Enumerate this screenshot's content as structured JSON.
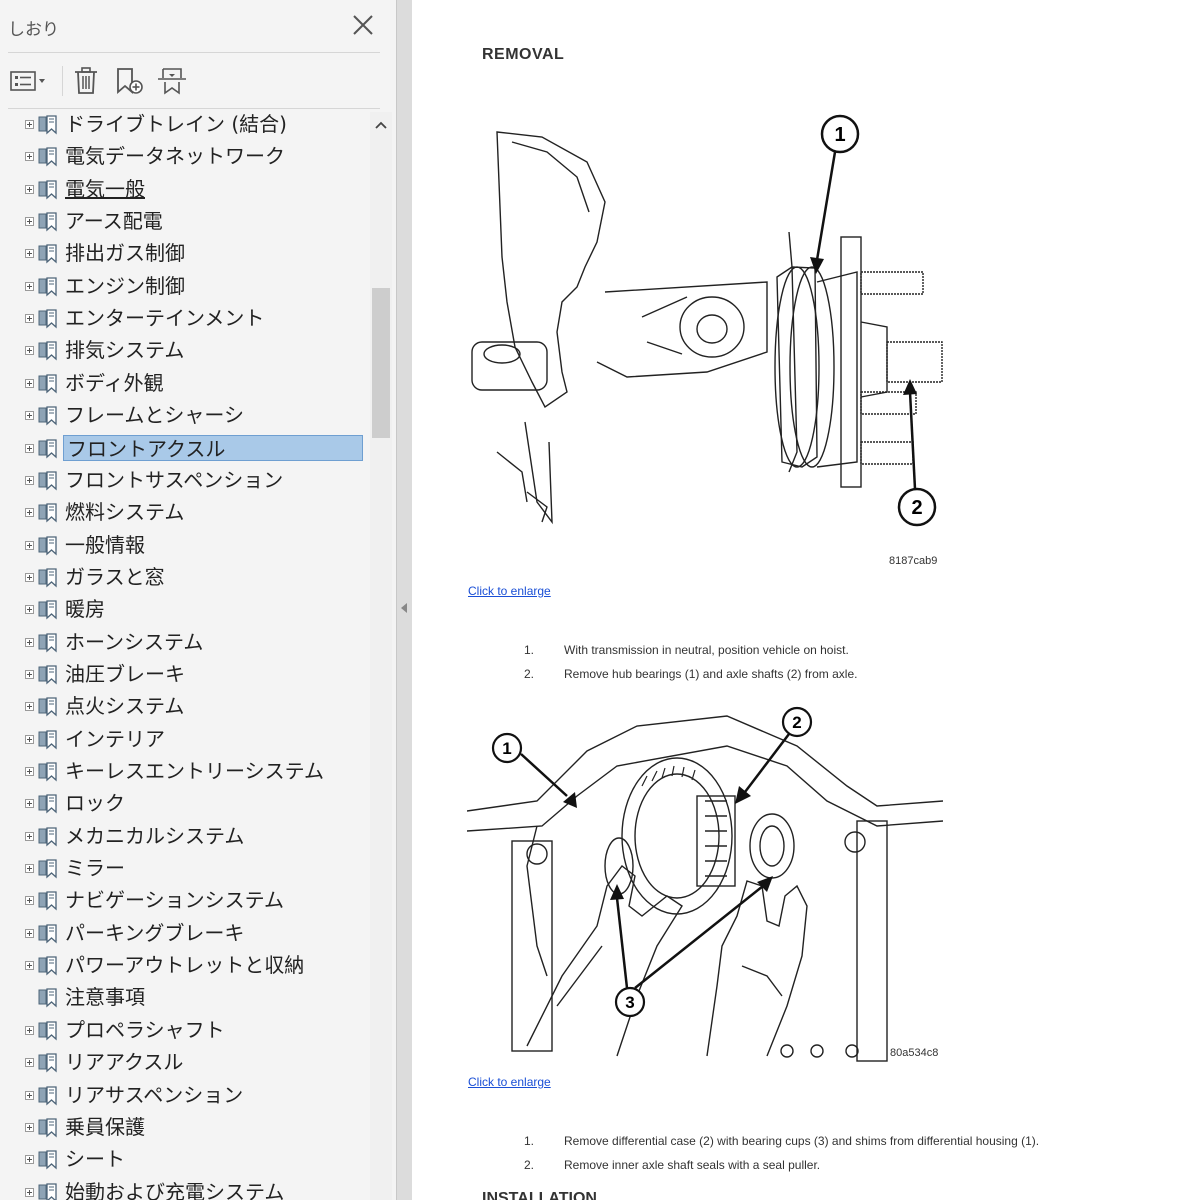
{
  "sidebar": {
    "title": "しおり",
    "items": [
      {
        "label": "ドライブトレイン (結合)",
        "expandable": true
      },
      {
        "label": "電気データネットワーク",
        "expandable": true
      },
      {
        "label": "電気一般",
        "expandable": true,
        "underline": true
      },
      {
        "label": "アース配電",
        "expandable": true
      },
      {
        "label": "排出ガス制御",
        "expandable": true
      },
      {
        "label": "エンジン制御",
        "expandable": true
      },
      {
        "label": "エンターテインメント",
        "expandable": true
      },
      {
        "label": "排気システム",
        "expandable": true
      },
      {
        "label": "ボディ外観",
        "expandable": true
      },
      {
        "label": "フレームとシャーシ",
        "expandable": true
      },
      {
        "label": "フロントアクスル",
        "expandable": true,
        "selected": true
      },
      {
        "label": "フロントサスペンション",
        "expandable": true
      },
      {
        "label": "燃料システム",
        "expandable": true
      },
      {
        "label": "一般情報",
        "expandable": true
      },
      {
        "label": "ガラスと窓",
        "expandable": true
      },
      {
        "label": "暖房",
        "expandable": true
      },
      {
        "label": "ホーンシステム",
        "expandable": true
      },
      {
        "label": "油圧ブレーキ",
        "expandable": true
      },
      {
        "label": "点火システム",
        "expandable": true
      },
      {
        "label": "インテリア",
        "expandable": true
      },
      {
        "label": "キーレスエントリーシステム",
        "expandable": true
      },
      {
        "label": "ロック",
        "expandable": true
      },
      {
        "label": "メカニカルシステム",
        "expandable": true
      },
      {
        "label": "ミラー",
        "expandable": true
      },
      {
        "label": "ナビゲーションシステム",
        "expandable": true
      },
      {
        "label": "パーキングブレーキ",
        "expandable": true
      },
      {
        "label": "パワーアウトレットと収納",
        "expandable": true
      },
      {
        "label": "注意事項",
        "expandable": false
      },
      {
        "label": "プロペラシャフト",
        "expandable": true
      },
      {
        "label": "リアアクスル",
        "expandable": true
      },
      {
        "label": "リアサスペンション",
        "expandable": true
      },
      {
        "label": "乗員保護",
        "expandable": true
      },
      {
        "label": "シート",
        "expandable": true
      },
      {
        "label": "始動および充電システム",
        "expandable": true
      }
    ]
  },
  "document": {
    "heading": "REMOVAL",
    "figure1": {
      "code": "8187cab9",
      "callouts": [
        "1",
        "2"
      ]
    },
    "figure2": {
      "code": "80a534c8",
      "callouts": [
        "1",
        "2",
        "3"
      ]
    },
    "link_label": "Click to enlarge",
    "steps1": [
      {
        "num": "1.",
        "text": "With transmission in neutral, position vehicle on hoist."
      },
      {
        "num": "2.",
        "text": "Remove hub bearings (1) and axle shafts (2) from axle."
      }
    ],
    "steps2": [
      {
        "num": "1.",
        "text": "Remove differential case (2) with bearing cups (3) and shims from differential housing (1)."
      },
      {
        "num": "2.",
        "text": "Remove inner axle shaft seals with a seal puller."
      }
    ],
    "next_heading": "INSTALLATION"
  },
  "colors": {
    "selection": "#a9c9e8",
    "link": "#1a4fd6"
  }
}
